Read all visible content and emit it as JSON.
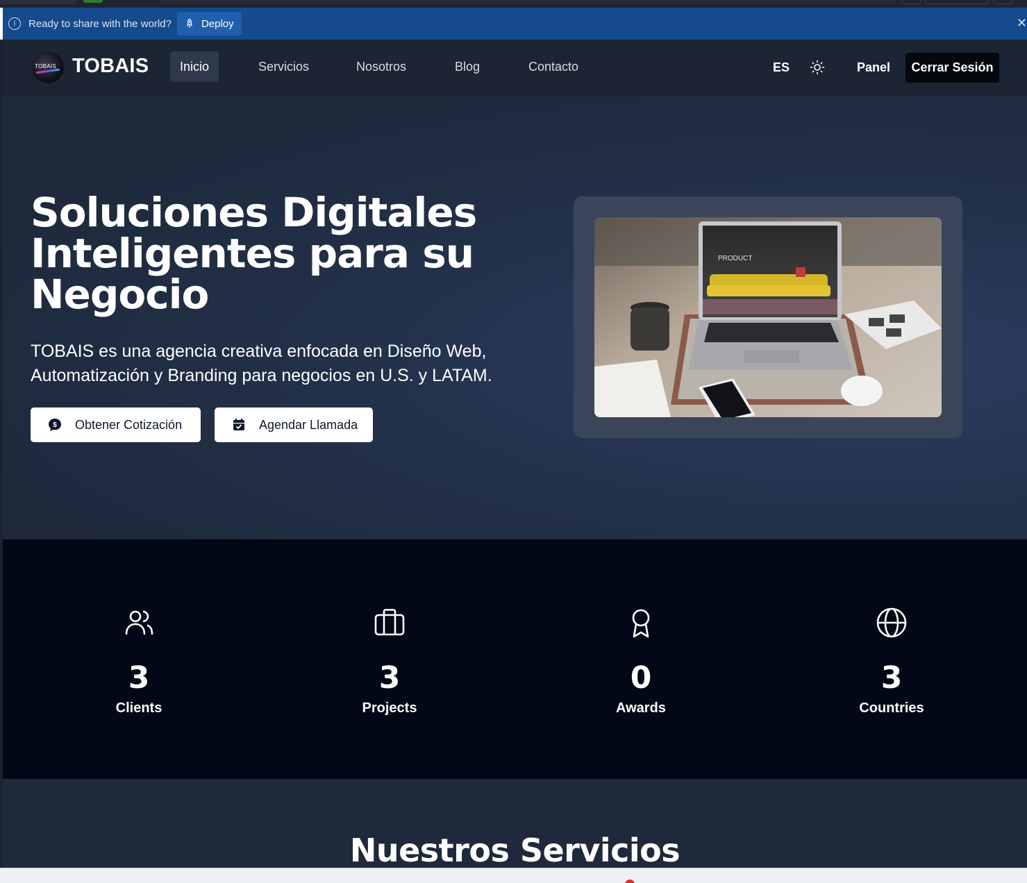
{
  "banner": {
    "message": "Ready to share with the world?",
    "deploy_label": "Deploy"
  },
  "nav": {
    "brand": "TOBAIS",
    "logo_text": "TOBAIS",
    "links": [
      {
        "label": "Inicio",
        "active": true
      },
      {
        "label": "Servicios",
        "active": false
      },
      {
        "label": "Nosotros",
        "active": false
      },
      {
        "label": "Blog",
        "active": false
      },
      {
        "label": "Contacto",
        "active": false
      }
    ],
    "language": "ES",
    "panel_label": "Panel",
    "logout_label": "Cerrar Sesión"
  },
  "hero": {
    "title": "Soluciones Digitales Inteligentes para su Negocio",
    "subtitle": "TOBAIS es una agencia creativa enfocada en Diseño Web, Automatización y Branding para negocios en U.S. y LATAM.",
    "cta_primary": "Obtener Cotización",
    "cta_secondary": "Agendar Llamada",
    "image_screen_text": "PRODUCT"
  },
  "stats": [
    {
      "icon": "users-icon",
      "value": "3",
      "label": "Clients"
    },
    {
      "icon": "briefcase-icon",
      "value": "3",
      "label": "Projects"
    },
    {
      "icon": "award-icon",
      "value": "0",
      "label": "Awards"
    },
    {
      "icon": "globe-icon",
      "value": "3",
      "label": "Countries"
    }
  ],
  "services": {
    "heading": "Nuestros Servicios"
  },
  "colors": {
    "banner_bg": "#154a8c",
    "nav_bg": "#1c2533",
    "hero_bg": "#1e293b",
    "stats_bg": "#030816",
    "accent_button": "#ffffff"
  }
}
